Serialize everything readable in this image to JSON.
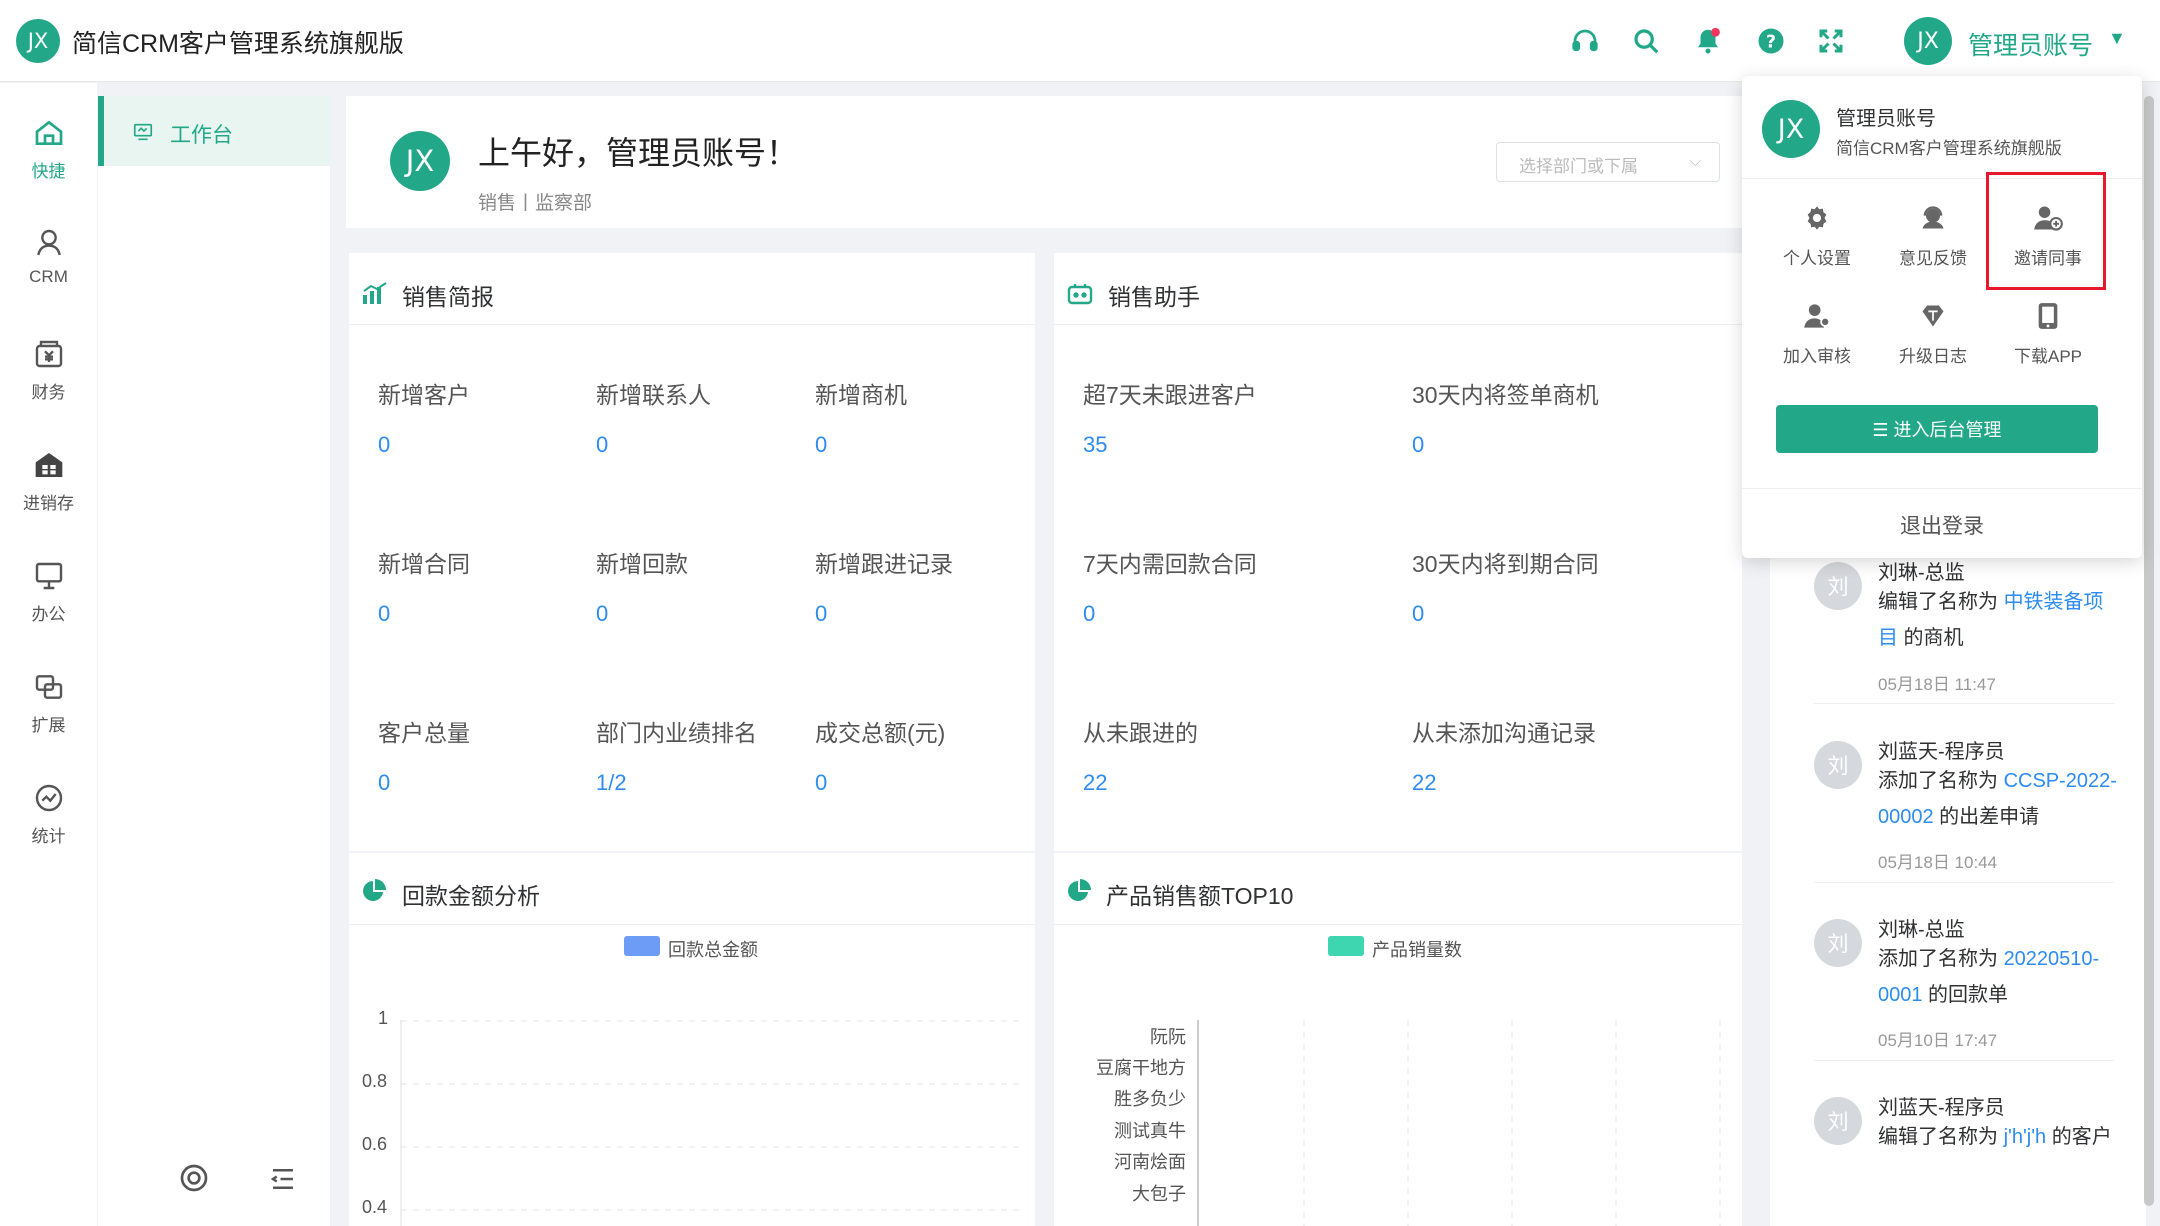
{
  "app": {
    "logo_text": "JX",
    "title": "简信CRM客户管理系统旗舰版"
  },
  "header": {
    "icons": [
      "headset-icon",
      "search-icon",
      "bell-icon",
      "help-icon",
      "fullscreen-icon"
    ],
    "user_avatar": "JX",
    "user_name": "管理员账号",
    "caret": "▼"
  },
  "nav": {
    "items": [
      {
        "label": "快捷",
        "icon": "home-icon"
      },
      {
        "label": "CRM",
        "icon": "user-icon"
      },
      {
        "label": "财务",
        "icon": "finance-icon"
      },
      {
        "label": "进销存",
        "icon": "warehouse-icon"
      },
      {
        "label": "办公",
        "icon": "monitor-icon"
      },
      {
        "label": "扩展",
        "icon": "extend-icon"
      },
      {
        "label": "统计",
        "icon": "stats-icon"
      }
    ]
  },
  "submenu": {
    "active_label": "工作台"
  },
  "greeting": {
    "avatar": "JX",
    "text": "上午好，管理员账号！",
    "sub": "销售丨监察部",
    "dept_placeholder": "选择部门或下属",
    "dept_arrow": "⌵"
  },
  "sales_brief": {
    "title": "销售简报",
    "stats": [
      {
        "label": "新增客户",
        "value": "0"
      },
      {
        "label": "新增联系人",
        "value": "0"
      },
      {
        "label": "新增商机",
        "value": "0"
      },
      {
        "label": "新增合同",
        "value": "0"
      },
      {
        "label": "新增回款",
        "value": "0"
      },
      {
        "label": "新增跟进记录",
        "value": "0"
      },
      {
        "label": "客户总量",
        "value": "0"
      },
      {
        "label": "部门内业绩排名",
        "value": "1/2"
      },
      {
        "label": "成交总额(元)",
        "value": "0"
      }
    ]
  },
  "sales_assistant": {
    "title": "销售助手",
    "stats": [
      {
        "label": "超7天未跟进客户",
        "value": "35"
      },
      {
        "label": "30天内将签单商机",
        "value": "0"
      },
      {
        "label": "7天内需回款合同",
        "value": "0"
      },
      {
        "label": "30天内将到期合同",
        "value": "0"
      },
      {
        "label": "从未跟进的",
        "value": "22"
      },
      {
        "label": "从未添加沟通记录",
        "value": "22"
      }
    ]
  },
  "payment_chart": {
    "title": "回款金额分析",
    "legend": "回款总金额",
    "color": "#6c9cf6"
  },
  "product_chart": {
    "title": "产品销售额TOP10",
    "legend": "产品销量数",
    "color": "#3ed6b0"
  },
  "chart_data": [
    {
      "type": "bar",
      "title": "回款金额分析",
      "series": [
        {
          "name": "回款总金额",
          "values": []
        }
      ],
      "y_ticks": [
        "1",
        "0.8",
        "0.6",
        "0.4"
      ],
      "ylim": [
        0,
        1
      ]
    },
    {
      "type": "bar",
      "title": "产品销售额TOP10",
      "orientation": "horizontal",
      "categories": [
        "阮阮",
        "豆腐干地方",
        "胜多负少",
        "测试真牛",
        "河南烩面",
        "大包子"
      ],
      "series": [
        {
          "name": "产品销量数",
          "values": []
        }
      ]
    }
  ],
  "activity": {
    "items": [
      {
        "avatar": "刘",
        "name": "刘琳-总监",
        "pre": "编辑了名称为 ",
        "link": "中铁装备项目",
        "post": " 的商机",
        "time": "05月18日 11:47"
      },
      {
        "avatar": "刘",
        "name": "刘蓝天-程序员",
        "pre": "添加了名称为 ",
        "link": "CCSP-2022-00002",
        "post": " 的出差申请",
        "time": "05月18日 10:44"
      },
      {
        "avatar": "刘",
        "name": "刘琳-总监",
        "pre": "添加了名称为 ",
        "link": "20220510-0001",
        "post": " 的回款单",
        "time": "05月10日 17:47"
      },
      {
        "avatar": "刘",
        "name": "刘蓝天-程序员",
        "pre": "编辑了名称为 ",
        "link": "j'h'j'h",
        "post": " 的客户",
        "time": ""
      }
    ]
  },
  "dropdown": {
    "avatar": "JX",
    "name": "管理员账号",
    "sub": "简信CRM客户管理系统旗舰版",
    "tiles": [
      {
        "label": "个人设置",
        "icon": "settings-icon"
      },
      {
        "label": "意见反馈",
        "icon": "feedback-icon"
      },
      {
        "label": "邀请同事",
        "icon": "invite-icon"
      },
      {
        "label": "加入审核",
        "icon": "join-review-icon"
      },
      {
        "label": "升级日志",
        "icon": "upgrade-log-icon"
      },
      {
        "label": "下载APP",
        "icon": "download-app-icon"
      }
    ],
    "admin_button": "☰ 进入后台管理",
    "logout": "退出登录"
  },
  "footer_icons": [
    "target-icon",
    "collapse-menu-icon"
  ]
}
